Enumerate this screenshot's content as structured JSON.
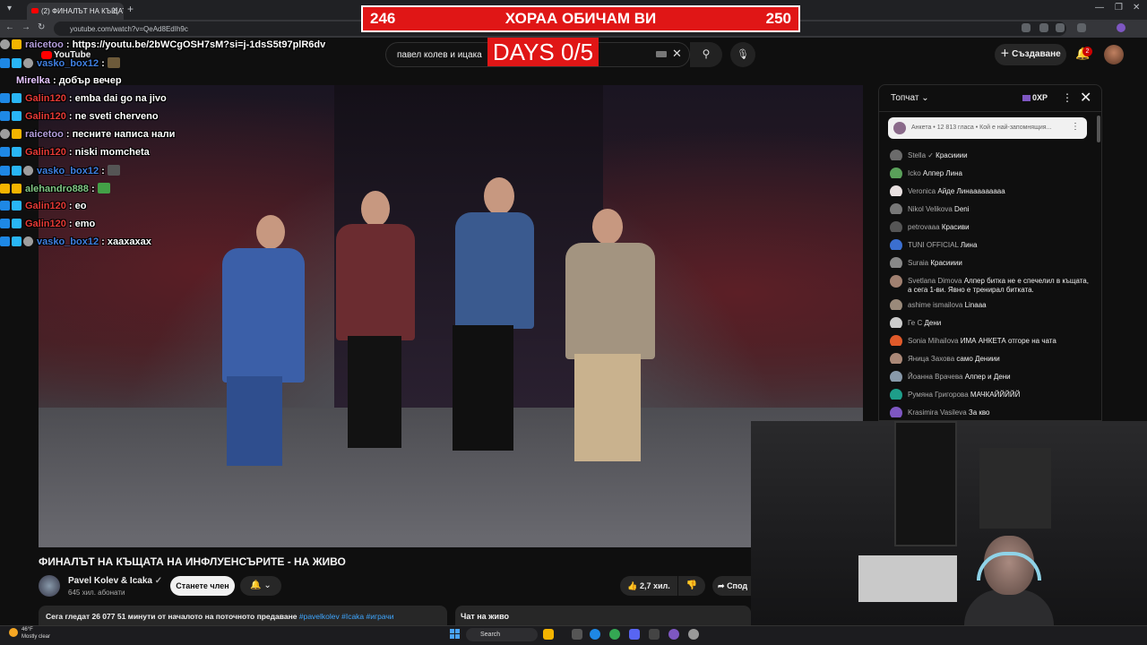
{
  "browser": {
    "tab_title": "(2) ФИНАЛЪТ НА КЪЩАТА",
    "url": "youtube.com/watch?v=QeAd8EdIh9c"
  },
  "overlay": {
    "score_left": "246",
    "score_center": "ХОРАА ОБИЧАМ ВИ",
    "score_right": "250",
    "days": "DAYS 0/5"
  },
  "youtube": {
    "logo": "YouTube",
    "search_value": "павел колев и ицака",
    "create_label": "Създаване",
    "notif_count": "2"
  },
  "stream_chat": [
    {
      "user": "raicetoo",
      "msg": "https://youtu.be/2bWCgOSH7sM?si=j-1dsS5t97plR6dv",
      "color": "#b39ddb",
      "badges": [
        "head",
        "gold"
      ]
    },
    {
      "user": "vasko_box12",
      "msg": "",
      "color": "#3f7fe0",
      "badges": [
        "blue",
        "cyan",
        "head"
      ],
      "emote": "#6d5a3a"
    },
    {
      "user": "Mirelka",
      "msg": "добър вечер",
      "color": "#e6c5ff",
      "badges": []
    },
    {
      "user": "Galin120",
      "msg": "emba dai go na jivo",
      "color": "#e53935",
      "badges": [
        "blue",
        "cyan"
      ]
    },
    {
      "user": "Galin120",
      "msg": "ne sveti cherveno",
      "color": "#e53935",
      "badges": [
        "blue",
        "cyan"
      ]
    },
    {
      "user": "raicetoo",
      "msg": "песните написа нали",
      "color": "#b39ddb",
      "badges": [
        "head",
        "gold"
      ]
    },
    {
      "user": "Galin120",
      "msg": "niski momcheta",
      "color": "#e53935",
      "badges": [
        "blue",
        "cyan"
      ]
    },
    {
      "user": "vasko_box12",
      "msg": "",
      "color": "#3f7fe0",
      "badges": [
        "blue",
        "cyan",
        "head"
      ],
      "emote": "#555555"
    },
    {
      "user": "alehandro888",
      "msg": "",
      "color": "#81c784",
      "badges": [
        "gold",
        "gold"
      ],
      "emote": "#43a047"
    },
    {
      "user": "Galin120",
      "msg": "eo",
      "color": "#e53935",
      "badges": [
        "blue",
        "cyan"
      ]
    },
    {
      "user": "Galin120",
      "msg": "emo",
      "color": "#e53935",
      "badges": [
        "blue",
        "cyan"
      ]
    },
    {
      "user": "vasko_box12",
      "msg": "хаахахах",
      "color": "#3f7fe0",
      "badges": [
        "blue",
        "cyan",
        "head"
      ]
    }
  ],
  "video": {
    "title": "ФИНАЛЪТ НА КЪЩАТА НА ИНФЛУЕНСЪРИТЕ - НА ЖИВО",
    "channel": "Pavel Kolev & Icaka",
    "subscribers": "645 хил. абонати",
    "join_label": "Станете член",
    "likes": "2,7 хил.",
    "share_label": "Спод",
    "desc_stats": "Сега гледат 26 077  51 минути от началото на поточното предаване",
    "desc_tags": "#pavelkolev #Icaka #играчи",
    "chat_label": "Чат на живо"
  },
  "live_chat": {
    "title": "Топчат",
    "xp": "0XP",
    "poll": "Анкета • 12 813 гласа • Кой е най-запомнящия...",
    "messages": [
      {
        "author": "Stella ✓",
        "msg": "Красииии",
        "avatar": "#6b6b6b"
      },
      {
        "author": "Icko",
        "msg": "Алпер Лина",
        "avatar": "#5aa05a"
      },
      {
        "author": "Veronica",
        "msg": "Айде Линааааааааа",
        "avatar": "#e8e0e0"
      },
      {
        "author": "Nikol Velikova",
        "msg": "Deni",
        "avatar": "#777777"
      },
      {
        "author": "petrovaaa",
        "msg": "Красиви",
        "avatar": "#555555"
      },
      {
        "author": "TUNI OFFICIAL",
        "msg": "Лина",
        "avatar": "#3b6fd0"
      },
      {
        "author": "Suraia",
        "msg": "Красииии",
        "avatar": "#888888"
      },
      {
        "author": "Svetlana Dimova",
        "msg": "Алпер битка не е спечелил в къщата, а сега 1-ви. Явно е тренирал битката.",
        "avatar": "#a08070"
      },
      {
        "author": "ashime ismailova",
        "msg": "Linaaa",
        "avatar": "#9a8a7a"
      },
      {
        "author": "Ге С",
        "msg": "Дени",
        "avatar": "#cccccc"
      },
      {
        "author": "Sonia Mihailova",
        "msg": "ИМА АНКЕТА отгоре на чата",
        "avatar": "#e05a2a"
      },
      {
        "author": "Яница Захова",
        "msg": "само Дениии",
        "avatar": "#aa8877"
      },
      {
        "author": "Йоанна Врачева",
        "msg": "Алпер и Дени",
        "avatar": "#8899aa"
      },
      {
        "author": "Румяна Григорова",
        "msg": "МАЧКАЙЙЙЙЙ",
        "avatar": "#1e9e8a"
      },
      {
        "author": "Krasimira Vasileva",
        "msg": "За кво",
        "avatar": "#7e57c2"
      }
    ]
  },
  "taskbar": {
    "temp": "46°F",
    "weather": "Mostly clear",
    "search": "Search"
  }
}
